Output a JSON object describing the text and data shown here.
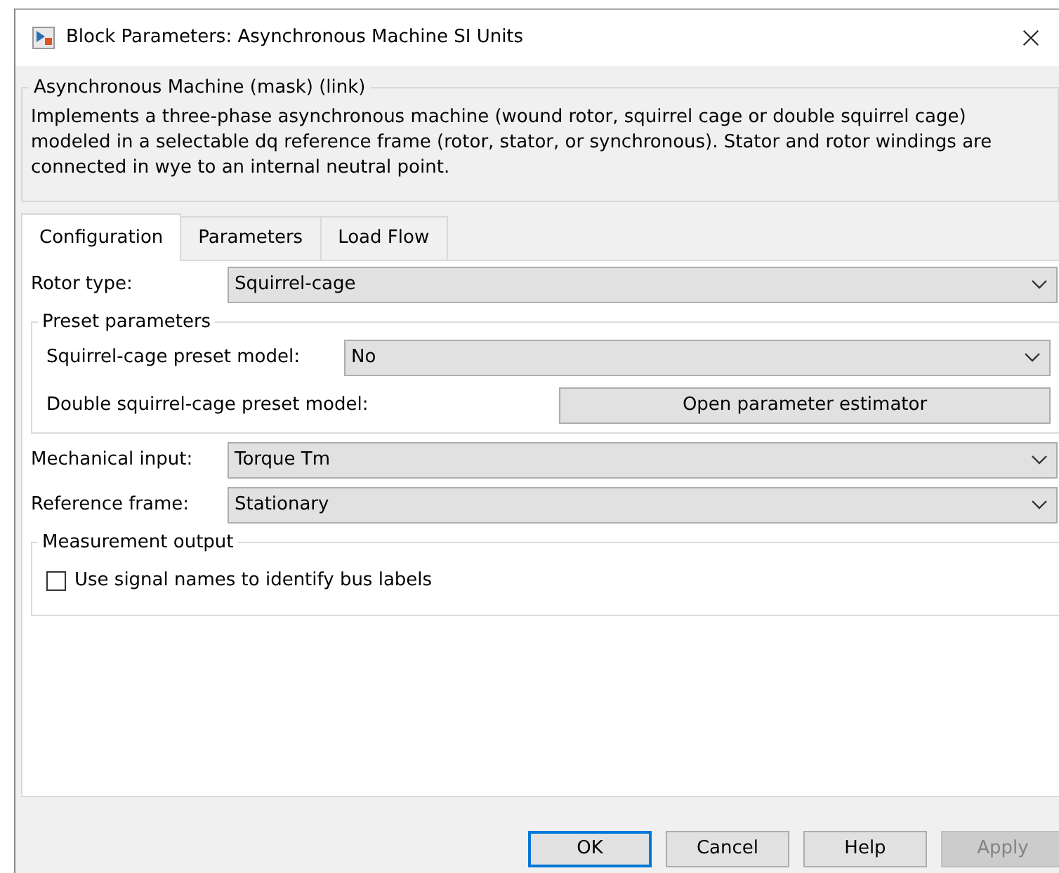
{
  "window": {
    "title": "Block Parameters: Asynchronous Machine SI Units"
  },
  "mask": {
    "title": "Asynchronous Machine (mask) (link)",
    "description": "Implements a three-phase asynchronous machine (wound rotor, squirrel cage or double squirrel cage) modeled in a selectable dq reference frame (rotor, stator, or synchronous). Stator and rotor windings are connected in wye to an internal neutral point."
  },
  "tabs": [
    {
      "label": "Configuration",
      "selected": true
    },
    {
      "label": "Parameters",
      "selected": false
    },
    {
      "label": "Load Flow",
      "selected": false
    }
  ],
  "items": [
    {
      "kind": "dropdown",
      "label": "Rotor type:",
      "value": "Squirrel-cage"
    },
    {
      "kind": "group",
      "title": "Preset parameters",
      "items": [
        {
          "kind": "dropdown",
          "label": "Squirrel-cage preset model:",
          "value": "No"
        },
        {
          "kind": "button",
          "label": "Double squirrel-cage preset model:",
          "button": "Open parameter estimator"
        }
      ]
    },
    {
      "kind": "dropdown",
      "label": "Mechanical input:",
      "value": "Torque Tm"
    },
    {
      "kind": "dropdown",
      "label": "Reference frame:",
      "value": "Stationary"
    },
    {
      "kind": "group",
      "title": "Measurement output",
      "items": [
        {
          "kind": "checkbox",
          "label": "Use signal names to identify bus labels",
          "checked": false
        }
      ]
    }
  ],
  "buttons": [
    {
      "label": "OK",
      "default": true,
      "disabled": false
    },
    {
      "label": "Cancel",
      "default": false,
      "disabled": false
    },
    {
      "label": "Help",
      "default": false,
      "disabled": false
    },
    {
      "label": "Apply",
      "default": false,
      "disabled": true
    }
  ]
}
